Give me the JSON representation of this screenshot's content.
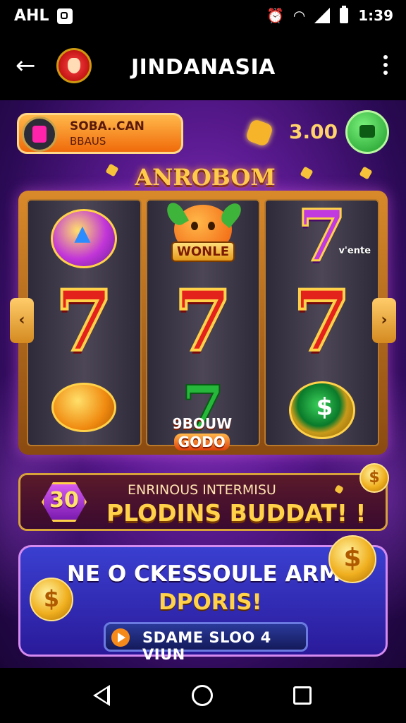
{
  "status_bar": {
    "left_text": "AHL",
    "time": "1:39"
  },
  "app_bar": {
    "title": "JINDANASIA"
  },
  "header": {
    "bonus_line1": "SOBA..CAN",
    "bonus_line2": "BBAUS",
    "balance": "3.00"
  },
  "slot": {
    "title": "ANROBOM",
    "reel1_label": "",
    "reel2_badge": "WONLE",
    "reel3_tag": "v'ente",
    "bottom_label1": "9BOUW",
    "bottom_label2": "GODO",
    "left_arrow": "‹",
    "right_arrow": "›"
  },
  "promo1": {
    "badge_number": "30",
    "line1": "ENRINOUS INTERMISU",
    "line2": "PLODINS BUDDAT! !"
  },
  "promo2": {
    "line1": "NE O CKESSOULE ARM",
    "line2": "DPORIS!",
    "button_label": "SDAME SLOO 4 VIUN"
  },
  "colors": {
    "accent_gold": "#ffd24a",
    "bg_purple": "#5a1a90",
    "seven_red": "#e4221c"
  }
}
